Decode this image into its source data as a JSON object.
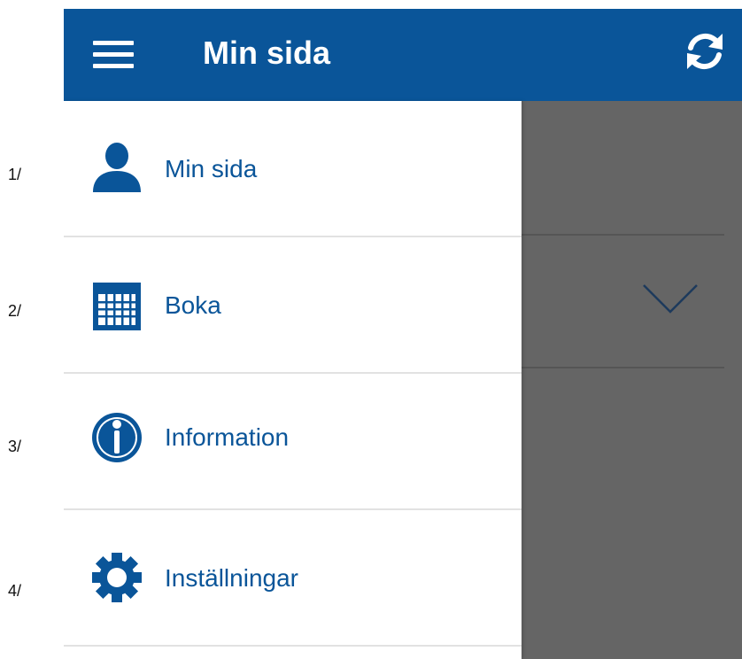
{
  "annotations": [
    "1/",
    "2/",
    "3/",
    "4/"
  ],
  "header": {
    "title": "Min sida",
    "background_color": "#0a5599",
    "menu_icon": "hamburger-menu-icon",
    "refresh_icon": "refresh-icon"
  },
  "drawer": {
    "items": [
      {
        "label": "Min sida",
        "icon": "person-icon"
      },
      {
        "label": "Boka",
        "icon": "calendar-icon"
      },
      {
        "label": "Information",
        "icon": "info-icon"
      },
      {
        "label": "Inställningar",
        "icon": "gear-icon"
      }
    ],
    "accent_color": "#0a5599"
  },
  "overlay": {
    "color": "#656565",
    "expand_icon": "chevron-down-icon"
  }
}
